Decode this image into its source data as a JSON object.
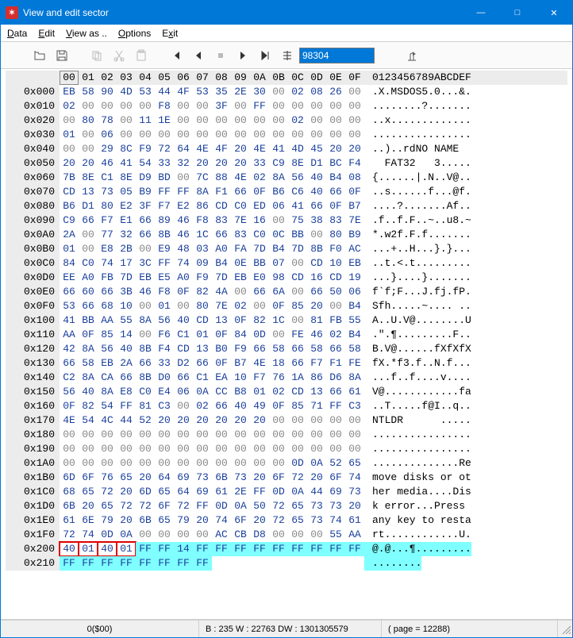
{
  "window": {
    "title": "View and edit sector",
    "icon_label": "app"
  },
  "window_buttons": {
    "minimize": "—",
    "maximize": "□",
    "close": "✕"
  },
  "menu": {
    "data": "Data",
    "edit": "Edit",
    "viewas": "View as ..",
    "options": "Options",
    "exit": "Exit"
  },
  "toolbar": {
    "sector_value": "98304"
  },
  "hex": {
    "col_headers": [
      "00",
      "01",
      "02",
      "03",
      "04",
      "05",
      "06",
      "07",
      "08",
      "09",
      "0A",
      "0B",
      "0C",
      "0D",
      "0E",
      "0F"
    ],
    "ascii_header": "0123456789ABCDEF",
    "rows": [
      {
        "off": "0x000",
        "b": [
          "EB",
          "58",
          "90",
          "4D",
          "53",
          "44",
          "4F",
          "53",
          "35",
          "2E",
          "30",
          "00",
          "02",
          "08",
          "26",
          "00"
        ],
        "a": ".X.MSDOS5.0...&."
      },
      {
        "off": "0x010",
        "b": [
          "02",
          "00",
          "00",
          "00",
          "00",
          "F8",
          "00",
          "00",
          "3F",
          "00",
          "FF",
          "00",
          "00",
          "00",
          "00",
          "00"
        ],
        "a": "........?......."
      },
      {
        "off": "0x020",
        "b": [
          "00",
          "80",
          "78",
          "00",
          "11",
          "1E",
          "00",
          "00",
          "00",
          "00",
          "00",
          "00",
          "02",
          "00",
          "00",
          "00"
        ],
        "a": "..x............."
      },
      {
        "off": "0x030",
        "b": [
          "01",
          "00",
          "06",
          "00",
          "00",
          "00",
          "00",
          "00",
          "00",
          "00",
          "00",
          "00",
          "00",
          "00",
          "00",
          "00"
        ],
        "a": "................"
      },
      {
        "off": "0x040",
        "b": [
          "00",
          "00",
          "29",
          "8C",
          "F9",
          "72",
          "64",
          "4E",
          "4F",
          "20",
          "4E",
          "41",
          "4D",
          "45",
          "20",
          "20"
        ],
        "a": "..)..rdNO NAME  "
      },
      {
        "off": "0x050",
        "b": [
          "20",
          "20",
          "46",
          "41",
          "54",
          "33",
          "32",
          "20",
          "20",
          "20",
          "33",
          "C9",
          "8E",
          "D1",
          "BC",
          "F4"
        ],
        "a": "  FAT32   3....."
      },
      {
        "off": "0x060",
        "b": [
          "7B",
          "8E",
          "C1",
          "8E",
          "D9",
          "BD",
          "00",
          "7C",
          "88",
          "4E",
          "02",
          "8A",
          "56",
          "40",
          "B4",
          "08"
        ],
        "a": "{......|.N..V@.."
      },
      {
        "off": "0x070",
        "b": [
          "CD",
          "13",
          "73",
          "05",
          "B9",
          "FF",
          "FF",
          "8A",
          "F1",
          "66",
          "0F",
          "B6",
          "C6",
          "40",
          "66",
          "0F"
        ],
        "a": "..s......f...@f."
      },
      {
        "off": "0x080",
        "b": [
          "B6",
          "D1",
          "80",
          "E2",
          "3F",
          "F7",
          "E2",
          "86",
          "CD",
          "C0",
          "ED",
          "06",
          "41",
          "66",
          "0F",
          "B7"
        ],
        "a": "....?.......Af.."
      },
      {
        "off": "0x090",
        "b": [
          "C9",
          "66",
          "F7",
          "E1",
          "66",
          "89",
          "46",
          "F8",
          "83",
          "7E",
          "16",
          "00",
          "75",
          "38",
          "83",
          "7E"
        ],
        "a": ".f..f.F..~..u8.~"
      },
      {
        "off": "0x0A0",
        "b": [
          "2A",
          "00",
          "77",
          "32",
          "66",
          "8B",
          "46",
          "1C",
          "66",
          "83",
          "C0",
          "0C",
          "BB",
          "00",
          "80",
          "B9"
        ],
        "a": "*.w2f.F.f......."
      },
      {
        "off": "0x0B0",
        "b": [
          "01",
          "00",
          "E8",
          "2B",
          "00",
          "E9",
          "48",
          "03",
          "A0",
          "FA",
          "7D",
          "B4",
          "7D",
          "8B",
          "F0",
          "AC"
        ],
        "a": "...+..H...}.}..."
      },
      {
        "off": "0x0C0",
        "b": [
          "84",
          "C0",
          "74",
          "17",
          "3C",
          "FF",
          "74",
          "09",
          "B4",
          "0E",
          "BB",
          "07",
          "00",
          "CD",
          "10",
          "EB"
        ],
        "a": "..t.<.t........."
      },
      {
        "off": "0x0D0",
        "b": [
          "EE",
          "A0",
          "FB",
          "7D",
          "EB",
          "E5",
          "A0",
          "F9",
          "7D",
          "EB",
          "E0",
          "98",
          "CD",
          "16",
          "CD",
          "19"
        ],
        "a": "...}....}......."
      },
      {
        "off": "0x0E0",
        "b": [
          "66",
          "60",
          "66",
          "3B",
          "46",
          "F8",
          "0F",
          "82",
          "4A",
          "00",
          "66",
          "6A",
          "00",
          "66",
          "50",
          "06"
        ],
        "a": "f`f;F...J.fj.fP."
      },
      {
        "off": "0x0F0",
        "b": [
          "53",
          "66",
          "68",
          "10",
          "00",
          "01",
          "00",
          "80",
          "7E",
          "02",
          "00",
          "0F",
          "85",
          "20",
          "00",
          "B4"
        ],
        "a": "Sfh.....~.... .."
      },
      {
        "off": "0x100",
        "b": [
          "41",
          "BB",
          "AA",
          "55",
          "8A",
          "56",
          "40",
          "CD",
          "13",
          "0F",
          "82",
          "1C",
          "00",
          "81",
          "FB",
          "55"
        ],
        "a": "A..U.V@........U"
      },
      {
        "off": "0x110",
        "b": [
          "AA",
          "0F",
          "85",
          "14",
          "00",
          "F6",
          "C1",
          "01",
          "0F",
          "84",
          "0D",
          "00",
          "FE",
          "46",
          "02",
          "B4"
        ],
        "a": ".\".¶.........F.."
      },
      {
        "off": "0x120",
        "b": [
          "42",
          "8A",
          "56",
          "40",
          "8B",
          "F4",
          "CD",
          "13",
          "B0",
          "F9",
          "66",
          "58",
          "66",
          "58",
          "66",
          "58"
        ],
        "a": "B.V@......fXfXfX"
      },
      {
        "off": "0x130",
        "b": [
          "66",
          "58",
          "EB",
          "2A",
          "66",
          "33",
          "D2",
          "66",
          "0F",
          "B7",
          "4E",
          "18",
          "66",
          "F7",
          "F1",
          "FE"
        ],
        "a": "fX.*f3.f..N.f..."
      },
      {
        "off": "0x140",
        "b": [
          "C2",
          "8A",
          "CA",
          "66",
          "8B",
          "D0",
          "66",
          "C1",
          "EA",
          "10",
          "F7",
          "76",
          "1A",
          "86",
          "D6",
          "8A"
        ],
        "a": "...f..f....v...."
      },
      {
        "off": "0x150",
        "b": [
          "56",
          "40",
          "8A",
          "E8",
          "C0",
          "E4",
          "06",
          "0A",
          "CC",
          "B8",
          "01",
          "02",
          "CD",
          "13",
          "66",
          "61"
        ],
        "a": "V@............fa"
      },
      {
        "off": "0x160",
        "b": [
          "0F",
          "82",
          "54",
          "FF",
          "81",
          "C3",
          "00",
          "02",
          "66",
          "40",
          "49",
          "0F",
          "85",
          "71",
          "FF",
          "C3"
        ],
        "a": "..T.....f@I..q.."
      },
      {
        "off": "0x170",
        "b": [
          "4E",
          "54",
          "4C",
          "44",
          "52",
          "20",
          "20",
          "20",
          "20",
          "20",
          "20",
          "00",
          "00",
          "00",
          "00",
          "00"
        ],
        "a": "NTLDR      ....."
      },
      {
        "off": "0x180",
        "b": [
          "00",
          "00",
          "00",
          "00",
          "00",
          "00",
          "00",
          "00",
          "00",
          "00",
          "00",
          "00",
          "00",
          "00",
          "00",
          "00"
        ],
        "a": "................"
      },
      {
        "off": "0x190",
        "b": [
          "00",
          "00",
          "00",
          "00",
          "00",
          "00",
          "00",
          "00",
          "00",
          "00",
          "00",
          "00",
          "00",
          "00",
          "00",
          "00"
        ],
        "a": "................"
      },
      {
        "off": "0x1A0",
        "b": [
          "00",
          "00",
          "00",
          "00",
          "00",
          "00",
          "00",
          "00",
          "00",
          "00",
          "00",
          "00",
          "0D",
          "0A",
          "52",
          "65"
        ],
        "a": "..............Re"
      },
      {
        "off": "0x1B0",
        "b": [
          "6D",
          "6F",
          "76",
          "65",
          "20",
          "64",
          "69",
          "73",
          "6B",
          "73",
          "20",
          "6F",
          "72",
          "20",
          "6F",
          "74"
        ],
        "a": "move disks or ot"
      },
      {
        "off": "0x1C0",
        "b": [
          "68",
          "65",
          "72",
          "20",
          "6D",
          "65",
          "64",
          "69",
          "61",
          "2E",
          "FF",
          "0D",
          "0A",
          "44",
          "69",
          "73"
        ],
        "a": "her media....Dis"
      },
      {
        "off": "0x1D0",
        "b": [
          "6B",
          "20",
          "65",
          "72",
          "72",
          "6F",
          "72",
          "FF",
          "0D",
          "0A",
          "50",
          "72",
          "65",
          "73",
          "73",
          "20"
        ],
        "a": "k error...Press "
      },
      {
        "off": "0x1E0",
        "b": [
          "61",
          "6E",
          "79",
          "20",
          "6B",
          "65",
          "79",
          "20",
          "74",
          "6F",
          "20",
          "72",
          "65",
          "73",
          "74",
          "61"
        ],
        "a": "any key to resta"
      },
      {
        "off": "0x1F0",
        "b": [
          "72",
          "74",
          "0D",
          "0A",
          "00",
          "00",
          "00",
          "00",
          "AC",
          "CB",
          "D8",
          "00",
          "00",
          "00",
          "55",
          "AA"
        ],
        "a": "rt............U."
      },
      {
        "off": "0x200",
        "b": [
          "40",
          "01",
          "40",
          "01",
          "FF",
          "FF",
          "14",
          "FF",
          "FF",
          "FF",
          "FF",
          "FF",
          "FF",
          "FF",
          "FF",
          "FF"
        ],
        "a": "@.@...¶.........",
        "sel": true,
        "redbox": 4
      },
      {
        "off": "0x210",
        "b": [
          "FF",
          "FF",
          "FF",
          "FF",
          "FF",
          "FF",
          "FF",
          "FF"
        ],
        "a": "........",
        "sel": true,
        "partial": 8
      }
    ]
  },
  "status": {
    "left": "0($00)",
    "bwdw": "B : 235 W : 22763 DW : 1301305579",
    "page": "( page = 12288)"
  }
}
